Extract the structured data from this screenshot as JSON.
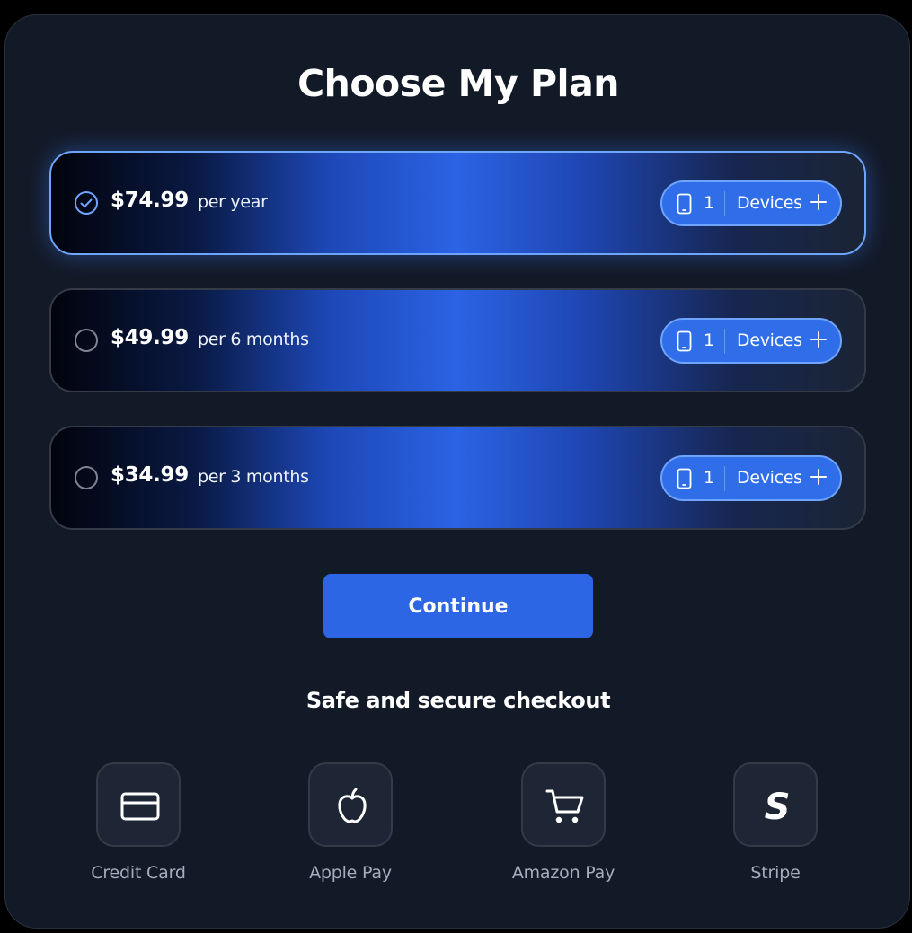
{
  "title": "Choose My Plan",
  "plans": [
    {
      "price": "$74.99",
      "period": "per year",
      "devices": "1",
      "devices_label": "Devices",
      "selected": true
    },
    {
      "price": "$49.99",
      "period": "per 6 months",
      "devices": "1",
      "devices_label": "Devices",
      "selected": false
    },
    {
      "price": "$34.99",
      "period": "per 3 months",
      "devices": "1",
      "devices_label": "Devices",
      "selected": false
    }
  ],
  "continue_label": "Continue",
  "secure_text": "Safe and secure checkout",
  "payment_methods": [
    {
      "label": "Credit Card",
      "icon": "credit-card-icon"
    },
    {
      "label": "Apple Pay",
      "icon": "apple-icon"
    },
    {
      "label": "Amazon Pay",
      "icon": "cart-icon"
    },
    {
      "label": "Stripe",
      "icon": "stripe-icon"
    }
  ],
  "colors": {
    "accent": "#2c66e5",
    "selected_border": "#6ea4fb",
    "card_background": "#131a27"
  }
}
